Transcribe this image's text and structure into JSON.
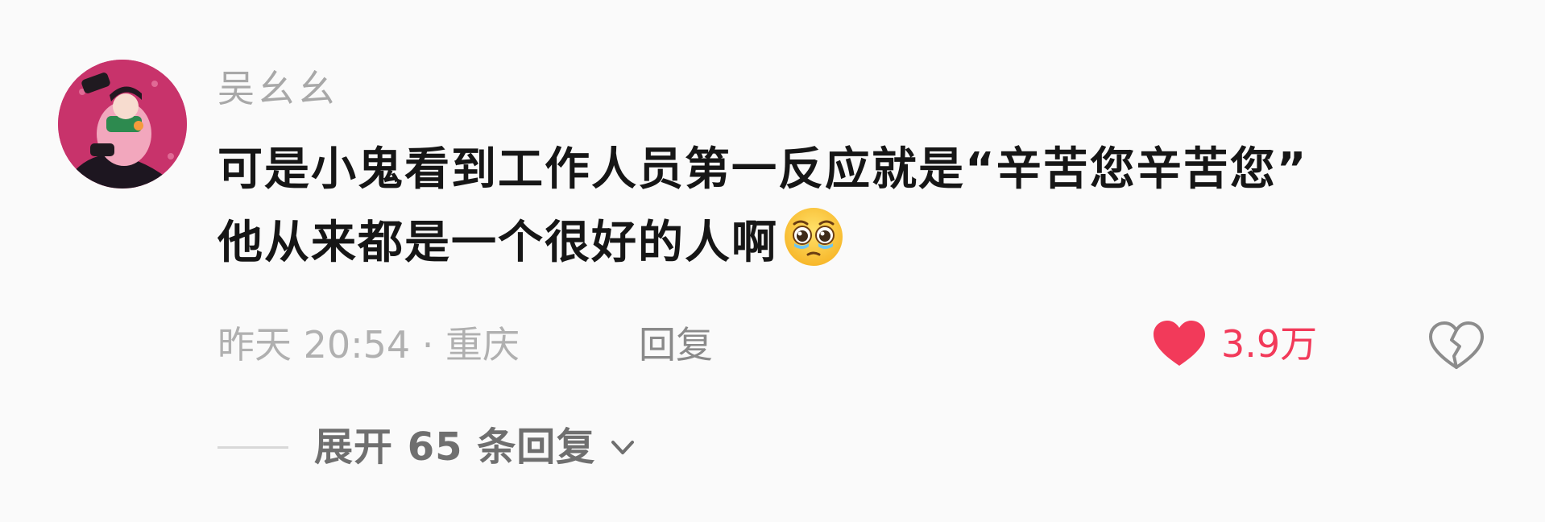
{
  "comment": {
    "username": "吴幺幺",
    "content_line1": "可是小鬼看到工作人员第一反应就是“辛苦您辛苦您”",
    "content_line2": "他从来都是一个很好的人啊",
    "content_emoji": "pleading-face-emoji",
    "meta": "昨天 20:54 · 重庆",
    "reply_label": "回复",
    "like_count": "3.9万",
    "expand_label": "展开 65 条回复",
    "colors": {
      "like": "#f23a5a",
      "avatar_bg": "#c8336b",
      "meta": "#b0b0b0"
    },
    "icons": {
      "like": "heart-icon",
      "dislike": "broken-heart-icon",
      "expand": "chevron-down-icon"
    }
  }
}
